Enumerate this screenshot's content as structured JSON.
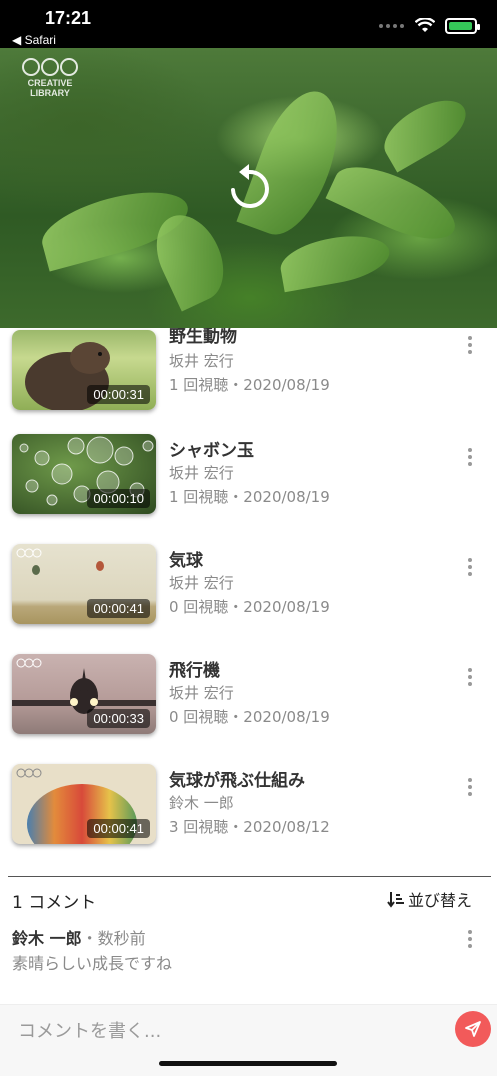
{
  "status_bar": {
    "time": "17:21",
    "back_label": "◀ Safari"
  },
  "player": {
    "logo_line1": "CREATIVE",
    "logo_line2": "LIBRARY",
    "replay_icon": "replay-icon"
  },
  "videos": [
    {
      "title": "野生動物",
      "author": "坂井 宏行",
      "meta": "1 回視聴・2020/08/19",
      "duration": "00:00:31",
      "thumb": "groundhog"
    },
    {
      "title": "シャボン玉",
      "author": "坂井 宏行",
      "meta": "1 回視聴・2020/08/19",
      "duration": "00:00:10",
      "thumb": "bubbles"
    },
    {
      "title": "気球",
      "author": "坂井 宏行",
      "meta": "0 回視聴・2020/08/19",
      "duration": "00:00:41",
      "thumb": "balloons"
    },
    {
      "title": "飛行機",
      "author": "坂井 宏行",
      "meta": "0 回視聴・2020/08/19",
      "duration": "00:00:33",
      "thumb": "airplane"
    },
    {
      "title": "気球が飛ぶ仕組み",
      "author": "鈴木 一郎",
      "meta": "3 回視聴・2020/08/12",
      "duration": "00:00:41",
      "thumb": "balloon-closeup"
    }
  ],
  "comments": {
    "count_label": "1 コメント",
    "sort_label": "並び替え",
    "items": [
      {
        "author": "鈴木 一郎",
        "time": "・数秒前",
        "text": "素晴らしい成長ですね"
      }
    ]
  },
  "composer": {
    "placeholder": "コメントを書く..."
  },
  "colors": {
    "accent": "#f25a5a",
    "battery": "#35c759"
  }
}
